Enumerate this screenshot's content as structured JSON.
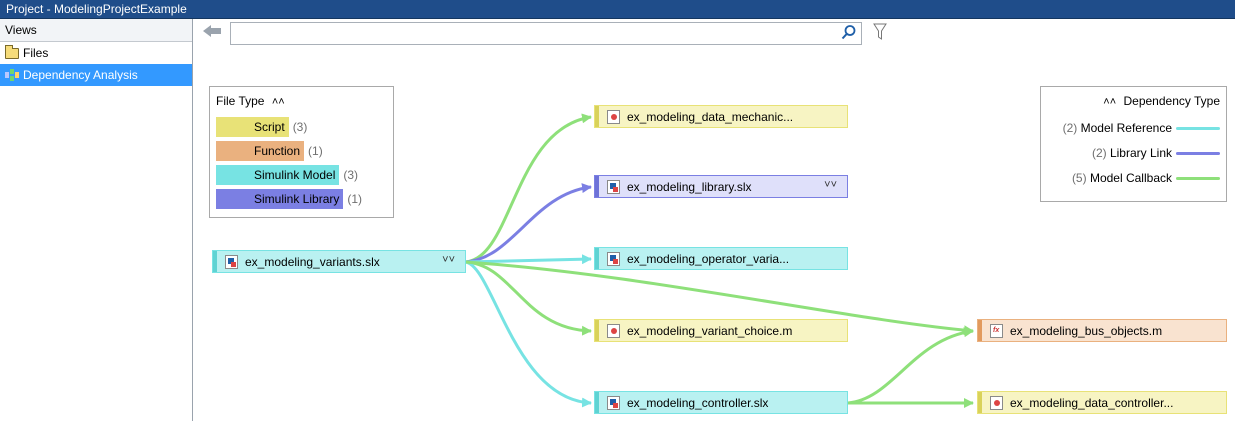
{
  "window": {
    "title": "Project - ModelingProjectExample"
  },
  "sidebar": {
    "header": "Views",
    "items": [
      {
        "label": "Files",
        "selected": false
      },
      {
        "label": "Dependency Analysis",
        "selected": true
      }
    ]
  },
  "toolbar": {
    "search": {
      "value": "",
      "placeholder": ""
    }
  },
  "file_type_legend": {
    "title": "File Type",
    "items": [
      {
        "label": "Script",
        "count": "(3)",
        "color": "#e8e277"
      },
      {
        "label": "Function",
        "count": "(1)",
        "color": "#eab17f"
      },
      {
        "label": "Simulink Model",
        "count": "(3)",
        "color": "#77e3e3"
      },
      {
        "label": "Simulink Library",
        "count": "(1)",
        "color": "#7b7fe3"
      }
    ]
  },
  "dependency_legend": {
    "title": "Dependency Type",
    "items": [
      {
        "count": "(2)",
        "label": "Model Reference",
        "color": "#77e3e3"
      },
      {
        "count": "(2)",
        "label": "Library Link",
        "color": "#7b7fe3"
      },
      {
        "count": "(5)",
        "label": "Model Callback",
        "color": "#8ee07a"
      }
    ]
  },
  "nodes": [
    {
      "id": "variants",
      "label": "ex_modeling_variants.slx",
      "type": "model"
    },
    {
      "id": "data_mech",
      "label": "ex_modeling_data_mechanic...",
      "type": "script"
    },
    {
      "id": "library",
      "label": "ex_modeling_library.slx",
      "type": "library"
    },
    {
      "id": "operator",
      "label": "ex_modeling_operator_varia...",
      "type": "model"
    },
    {
      "id": "choice",
      "label": "ex_modeling_variant_choice.m",
      "type": "script"
    },
    {
      "id": "controller",
      "label": "ex_modeling_controller.slx",
      "type": "model"
    },
    {
      "id": "bus",
      "label": "ex_modeling_bus_objects.m",
      "type": "function"
    },
    {
      "id": "data_ctrl",
      "label": "ex_modeling_data_controller...",
      "type": "script"
    }
  ]
}
